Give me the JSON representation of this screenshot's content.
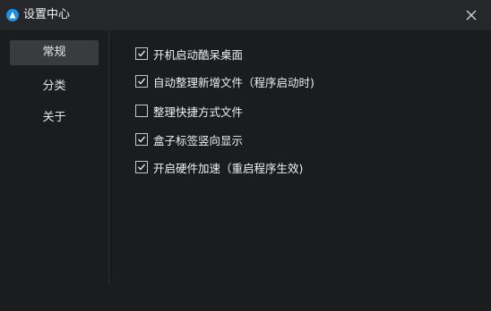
{
  "window": {
    "title": "设置中心",
    "icon": "app-logo-icon",
    "close_icon": "close-icon"
  },
  "sidebar": {
    "items": [
      {
        "label": "常规",
        "active": true
      },
      {
        "label": "分类",
        "active": false
      },
      {
        "label": "关于",
        "active": false
      }
    ]
  },
  "options": [
    {
      "label": "开机启动酷呆桌面",
      "checked": true
    },
    {
      "label": "自动整理新增文件（程序启动时)",
      "checked": true
    },
    {
      "label": "整理快捷方式文件",
      "checked": false
    },
    {
      "label": "盒子标签竖向显示",
      "checked": true
    },
    {
      "label": "开启硬件加速（重启程序生效)",
      "checked": true
    }
  ],
  "colors": {
    "background": "#1b1c1e",
    "titlebar": "#26272a",
    "active_nav": "#3a3b3f",
    "accent": "#1e8fe6"
  }
}
